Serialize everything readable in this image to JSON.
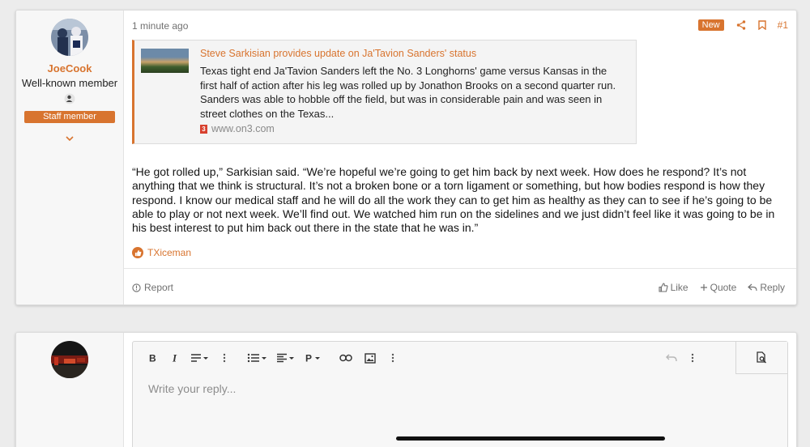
{
  "post": {
    "author": {
      "username": "JoeCook",
      "title": "Well-known member",
      "badge": "Staff member"
    },
    "time": "1 minute ago",
    "new_label": "New",
    "number": "#1",
    "embed": {
      "title": "Steve Sarkisian provides update on Ja'Tavion Sanders' status",
      "text": "Texas tight end Ja'Tavion Sanders left the No. 3 Longhorns' game versus Kansas in the first half of action after his leg was rolled up by Jonathon Brooks on a second quarter run. Sanders was able to hobble off the field, but was in considerable pain and was seen in street clothes on the Texas...",
      "source": "www.on3.com",
      "source_icon_text": "3"
    },
    "body": "“He got rolled up,” Sarkisian said. “We’re hopeful we’re going to get him back by next week. How does he respond? It’s not anything that we think is structural. It’s not a broken bone or a torn ligament or something, but how bodies respond is how they respond. I know our medical staff and he will do all the work they can to get him as healthy as they can to see if he’s going to be able to play or not next week. We’ll find out. We watched him run on the sidelines and we just didn’t feel like it was going to be in his best interest to put him back out there in the state that he was in.”",
    "reaction_user": "TXiceman",
    "footer": {
      "report": "Report",
      "like": "Like",
      "quote": "Quote",
      "reply": "Reply"
    }
  },
  "reply": {
    "placeholder": "Write your reply..."
  },
  "colors": {
    "accent": "#d8742f",
    "background": "#ececec"
  }
}
